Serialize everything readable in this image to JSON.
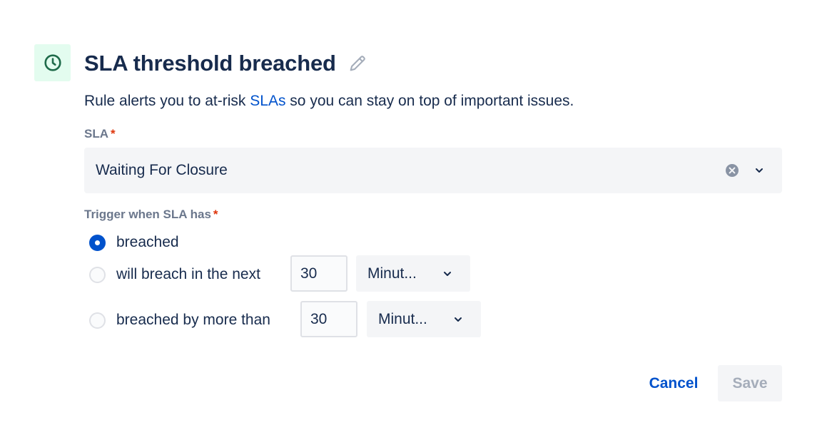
{
  "header": {
    "title": "SLA threshold breached",
    "icon": "clock-icon",
    "icon_bg_color": "#e3fcef",
    "icon_color": "#006644"
  },
  "description": {
    "before_link": "Rule alerts you to at-risk ",
    "link_text": "SLAs",
    "after_link": " so you can stay on top of important issues."
  },
  "sla_field": {
    "label": "SLA",
    "required_marker": "*",
    "selected_value": "Waiting For Closure"
  },
  "trigger_field": {
    "label": "Trigger when SLA has",
    "required_marker": "*",
    "options": [
      {
        "label": "breached",
        "checked": true
      },
      {
        "label": "will breach in the next",
        "checked": false,
        "amount": "30",
        "unit": "Minut..."
      },
      {
        "label": "breached by more than",
        "checked": false,
        "amount": "30",
        "unit": "Minut..."
      }
    ]
  },
  "actions": {
    "cancel_label": "Cancel",
    "save_label": "Save"
  },
  "colors": {
    "link": "#0052cc",
    "required": "#de350b",
    "radio_checked": "#0052cc"
  }
}
